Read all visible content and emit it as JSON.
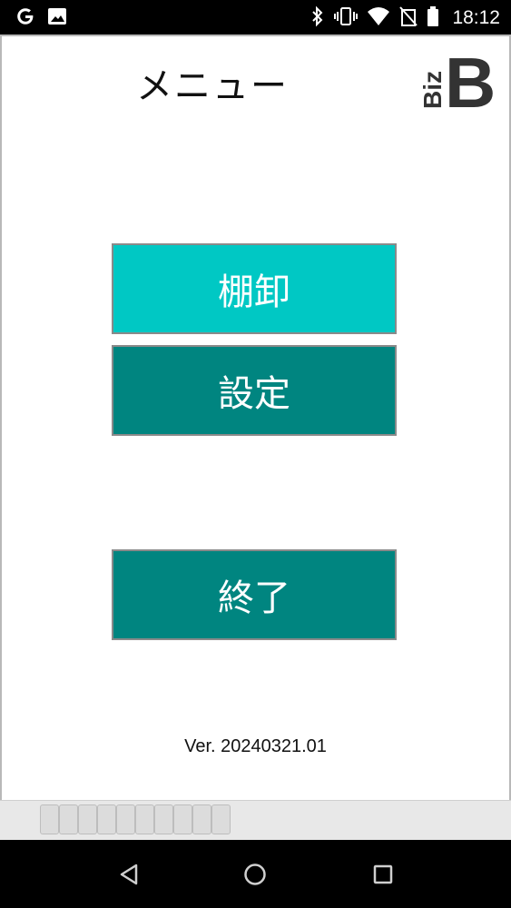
{
  "status_bar": {
    "time": "18:12",
    "left_icons": [
      "google-icon",
      "image-icon"
    ],
    "right_icons": [
      "bluetooth-icon",
      "vibrate-icon",
      "wifi-icon",
      "no-sim-icon",
      "battery-icon"
    ]
  },
  "header": {
    "title": "メニュー",
    "logo_text": "Biz",
    "logo_letter": "B"
  },
  "menu": {
    "inventory_label": "棚卸",
    "settings_label": "設定",
    "exit_label": "終了"
  },
  "footer": {
    "version": "Ver. 20240321.01"
  },
  "colors": {
    "inventory_button": "#00c8c4",
    "primary_button": "#008580"
  },
  "nav_bar": {
    "icons": [
      "back-icon",
      "home-icon",
      "recents-icon"
    ]
  }
}
